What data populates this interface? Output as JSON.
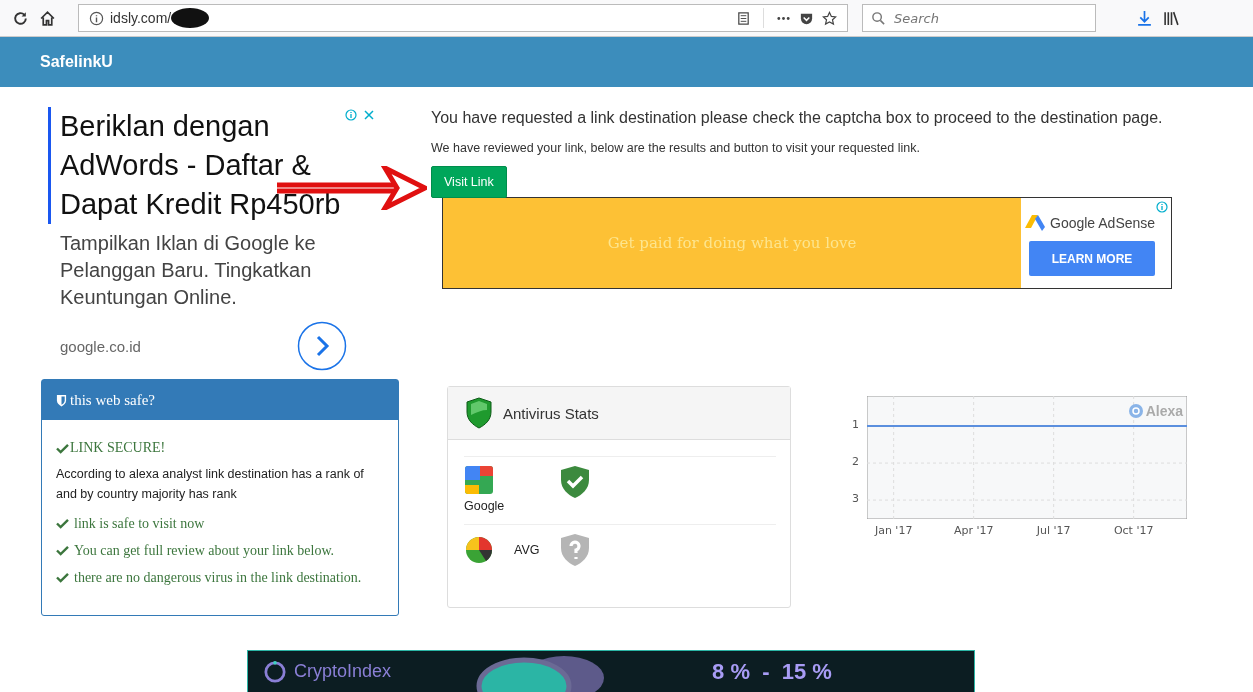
{
  "browser": {
    "url": "idsly.com/",
    "search_placeholder": "Search"
  },
  "header": {
    "brand": "**S**afelink**U**"
  },
  "ad_left": {
    "headline": "Beriklan dengan AdWords - Daftar & Dapat Kredit Rp450rb",
    "body": "Tampilkan Iklan di Google ke Pelanggan Baru. Tingkatkan Keuntungan Online.",
    "domain": "google.co.id"
  },
  "main": {
    "heading": "You have requested a link destination please check the captcha box to proceed to the destination page.",
    "subtext": "We have reviewed your link, below are the results and button to visit your requested link.",
    "button": "Visit Link"
  },
  "adsense": {
    "tagline": "Get paid for doing what you love",
    "brand": "Google AdSense",
    "button": "LEARN MORE"
  },
  "safety_panel": {
    "title": "this web safe?",
    "status": "LINK SECURE!",
    "description": "According to alexa analyst link destination has a rank of and by country majority has rank",
    "points": [
      "link is safe to visit now",
      "You can get full review about your link below.",
      "there are no dangerous virus in the link destination."
    ]
  },
  "antivirus": {
    "title": "Antivirus Stats",
    "rows": [
      {
        "name": "Google",
        "kind": "google",
        "verified": true
      },
      {
        "name": "AVG",
        "kind": "avg",
        "verified": false
      }
    ]
  },
  "alexa": {
    "logo": "Alexa",
    "chart_data": {
      "type": "line",
      "categories": [
        null,
        "Jan '17",
        null,
        null,
        "Apr '17",
        null,
        null,
        "Jul '17",
        null,
        null,
        "Oct '17",
        null,
        null
      ],
      "series": [
        {
          "color": "#5b8fde",
          "values": [
            1,
            1,
            1,
            1,
            1,
            1,
            1,
            1,
            1,
            1,
            1,
            1,
            1
          ]
        }
      ],
      "grid": true,
      "ylim": [
        3.51,
        0.19
      ],
      "yticks": [
        1,
        2,
        3
      ]
    }
  },
  "banner": {
    "brand": "CryptoIndex",
    "rate": "8 %  -  15 %"
  }
}
